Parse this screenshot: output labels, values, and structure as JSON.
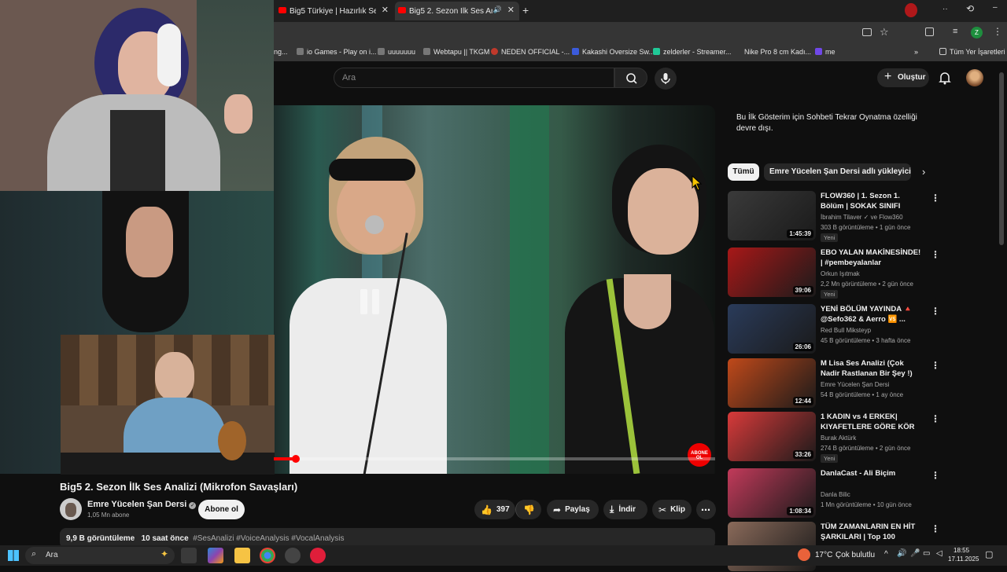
{
  "browser": {
    "tabs": [
      {
        "label": "Big5 Türkiye | Hazırlık Sezonu B..."
      },
      {
        "label": "Big5 2. Sezon İlk Ses Analiz..."
      }
    ],
    "bookmarks": [
      "ing...",
      "io Games - Play on i...",
      "uuuuuuu",
      "Webtapu || TKGM",
      "NEDEN OFFICIAL -...",
      "Kakashi Oversize Sw...",
      "zelderler - Streamer...",
      "Nike Pro 8 cm Kadı...",
      "me"
    ],
    "all_bookmarks": "Tüm Yer İşaretleri",
    "profile_initial": "Z"
  },
  "header": {
    "search_placeholder": "Ara",
    "create_label": "Oluştur"
  },
  "video": {
    "title": "Big5 2. Sezon İlk Ses Analizi (Mikrofon Savaşları)",
    "channel": "Emre Yücelen Şan Dersi",
    "subscribers": "1,05 Mn abone",
    "subscribe_label": "Abone ol",
    "likes": "397",
    "share_label": "Paylaş",
    "download_label": "İndir",
    "clip_label": "Klip",
    "views": "9,9 B görüntüleme",
    "age": "10 saat önce",
    "hashtags": "#SesAnalizi #VoiceAnalysis #VocalAnalysis",
    "watermark": "ABONE OL",
    "progress": 0.05
  },
  "sidebar": {
    "chat_notice": "Bu İlk Gösterim için Sohbeti Tekrar Oynatma özelliği devre dışı.",
    "chips": [
      "Tümü",
      "Emre Yücelen Şan Dersi adlı yükleyiciden"
    ],
    "recommendations": [
      {
        "title": "FLOW360 | 1. Sezon 1. Bölüm | SOKAK SINIFI (Official Video)",
        "channel": "İbrahim Tilaver ✓ ve Flow360",
        "meta": "303 B görüntüleme • 1 gün önce",
        "duration": "1:45:39",
        "badge": "Yeni",
        "color": "#3a3a3a"
      },
      {
        "title": "EBO YALAN MAKİNESİNDE! | #pembeyalanlar",
        "channel": "Orkun Işıtmak",
        "meta": "2,2 Mn görüntüleme • 2 gün önce",
        "duration": "39:06",
        "badge": "Yeni",
        "color": "#a81818"
      },
      {
        "title": "YENİ BÖLÜM YAYINDA 🔺 @Sefo362 & Aerro 🆚 ...",
        "channel": "Red Bull Mikstеyp",
        "meta": "45 B görüntüleme • 3 hafta önce",
        "duration": "26:06",
        "badge": "",
        "color": "#2a3b5a"
      },
      {
        "title": "M Lisa Ses Analizi (Çok Nadir Rastlanan Bir Şey !)",
        "channel": "Emre Yücelen Şan Dersi",
        "meta": "54 B görüntüleme • 1 ay önce",
        "duration": "12:44",
        "badge": "",
        "color": "#c0491a"
      },
      {
        "title": "1 KADIN vs 4 ERKEK| KIYAFETLERE GÖRE KÖR ...",
        "channel": "Burak Aktürk",
        "meta": "274 B görüntüleme • 2 gün önce",
        "duration": "33:26",
        "badge": "Yeni",
        "color": "#d83a3a"
      },
      {
        "title": "DanlaCast - Ali Biçim",
        "channel": "Danla Bilic",
        "meta": "1 Mn görüntüleme • 10 gün önce",
        "duration": "1:08:34",
        "badge": "",
        "color": "#c23a5a"
      },
      {
        "title": "TÜM ZAMANLARIN EN HİT ŞARKILARI | Top 100",
        "channel": "",
        "meta": "",
        "duration": "",
        "badge": "",
        "color": "#8a6a5a"
      }
    ]
  },
  "taskbar": {
    "search_label": "Ara",
    "weather": "17°C",
    "weather_desc": "Çok bulutlu",
    "time": "18:55",
    "date": "17.11.2025"
  }
}
